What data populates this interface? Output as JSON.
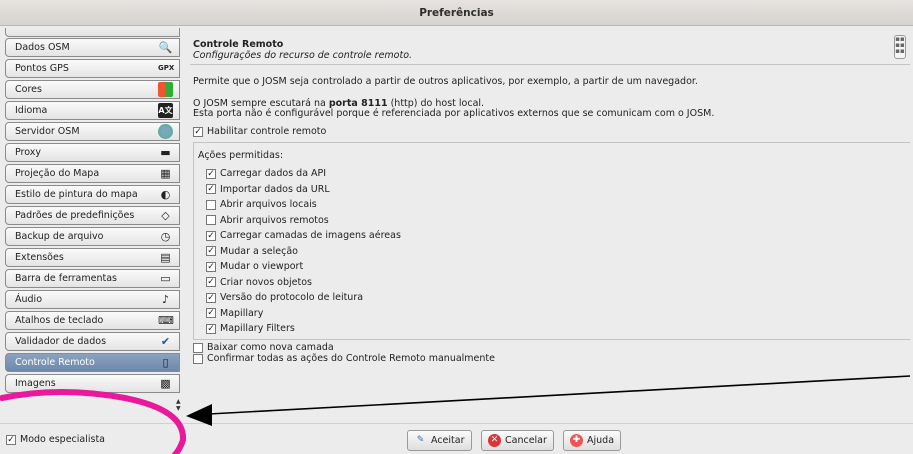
{
  "window": {
    "title": "Preferências"
  },
  "sidebar": {
    "items": [
      {
        "label": "Dados OSM",
        "icon": "search-icon"
      },
      {
        "label": "Pontos GPS",
        "icon": "gpx-icon",
        "icon_text": "GPX"
      },
      {
        "label": "Cores",
        "icon": "colors-icon"
      },
      {
        "label": "Idioma",
        "icon": "language-icon",
        "icon_text": "A文"
      },
      {
        "label": "Servidor OSM",
        "icon": "globe-icon"
      },
      {
        "label": "Proxy",
        "icon": "proxy-icon"
      },
      {
        "label": "Projeção do Mapa",
        "icon": "projection-icon"
      },
      {
        "label": "Estilo de pintura do mapa",
        "icon": "paint-style-icon"
      },
      {
        "label": "Padrões de predefinições",
        "icon": "preset-icon"
      },
      {
        "label": "Backup de arquivo",
        "icon": "clock-icon"
      },
      {
        "label": "Extensões",
        "icon": "plugin-icon"
      },
      {
        "label": "Barra de ferramentas",
        "icon": "toolbar-icon"
      },
      {
        "label": "Áudio",
        "icon": "audio-icon"
      },
      {
        "label": "Atalhos de teclado",
        "icon": "keyboard-icon"
      },
      {
        "label": "Validador de dados",
        "icon": "checkmark-icon"
      },
      {
        "label": "Controle Remoto",
        "icon": "remote-icon",
        "active": true
      },
      {
        "label": "Imagens",
        "icon": "imagery-icon"
      }
    ]
  },
  "main": {
    "title": "Controle Remoto",
    "subtitle": "Configurações do recurso de controle remoto.",
    "description": "Permite que o JOSM seja controlado a partir de outros aplicativos, por exemplo, a partir de um navegador.",
    "port_prefix": "O JOSM sempre escutará na ",
    "port_bold": "porta 8111",
    "port_suffix": " (http) do host local.",
    "port_note": "Esta porta não é configurável porque é referenciada por aplicativos externos que se comunicam com o JOSM.",
    "enable_label": "Habilitar controle remoto",
    "enable_checked": true,
    "actions_title": "Ações permitidas:",
    "actions": [
      {
        "label": "Carregar dados da API",
        "checked": true
      },
      {
        "label": "Importar dados da URL",
        "checked": true
      },
      {
        "label": "Abrir arquivos locais",
        "checked": false
      },
      {
        "label": "Abrir arquivos remotos",
        "checked": false
      },
      {
        "label": "Carregar camadas de imagens aéreas",
        "checked": true
      },
      {
        "label": "Mudar a seleção",
        "checked": true
      },
      {
        "label": "Mudar o viewport",
        "checked": true
      },
      {
        "label": "Criar novos objetos",
        "checked": true
      },
      {
        "label": "Versão do protocolo de leitura",
        "checked": true
      },
      {
        "label": "Mapillary",
        "checked": true
      },
      {
        "label": "Mapillary Filters",
        "checked": true
      }
    ],
    "new_layer_label": "Baixar como nova camada",
    "new_layer_checked": false,
    "confirm_all_label": "Confirmar todas as ações do Controle Remoto manualmente",
    "confirm_all_checked": false
  },
  "footer": {
    "expert_label": "Modo especialista",
    "expert_checked": true,
    "ok_label": "Aceitar",
    "cancel_label": "Cancelar",
    "help_label": "Ajuda"
  },
  "annotation": {
    "circle_color": "#e8199a",
    "arrow_color": "#000000"
  }
}
